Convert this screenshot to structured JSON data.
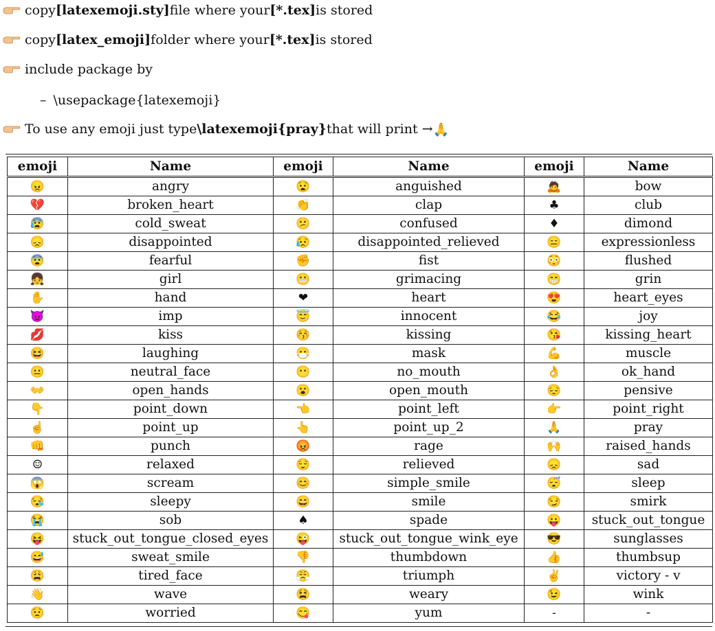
{
  "bullets": [
    {
      "pre": "copy ",
      "b1": "[latexemoji.sty]",
      "mid": " file where your ",
      "b2": "[*.tex]",
      "post": " is stored"
    },
    {
      "pre": "copy ",
      "b1": "[latex_emoji]",
      "mid": " folder where your ",
      "b2": "[*.tex]",
      "post": " is stored"
    },
    {
      "pre": "include package by"
    }
  ],
  "sub_item": "\\usepackage{latexemoji}",
  "usage": {
    "pre": "To use any emoji just type ",
    "cmd": "\\latexemoji{pray}",
    "post": " that will print → ",
    "emoji": "🙏"
  },
  "table": {
    "headers": [
      "emoji",
      "Name",
      "emoji",
      "Name",
      "emoji",
      "Name"
    ],
    "rows": [
      [
        {
          "e": "😠",
          "n": "angry"
        },
        {
          "e": "😧",
          "n": "anguished"
        },
        {
          "e": "🙇",
          "n": "bow"
        }
      ],
      [
        {
          "e": "💔",
          "n": "broken_heart"
        },
        {
          "e": "👏",
          "n": "clap"
        },
        {
          "e": "♣",
          "n": "club"
        }
      ],
      [
        {
          "e": "😰",
          "n": "cold_sweat"
        },
        {
          "e": "😕",
          "n": "confused"
        },
        {
          "e": "♦",
          "n": "dimond"
        }
      ],
      [
        {
          "e": "😞",
          "n": "disappointed"
        },
        {
          "e": "😥",
          "n": "disappointed_relieved"
        },
        {
          "e": "😑",
          "n": "expressionless"
        }
      ],
      [
        {
          "e": "😨",
          "n": "fearful"
        },
        {
          "e": "✊",
          "n": "fist"
        },
        {
          "e": "😳",
          "n": "flushed"
        }
      ],
      [
        {
          "e": "👧",
          "n": "girl"
        },
        {
          "e": "😬",
          "n": "grimacing"
        },
        {
          "e": "😁",
          "n": "grin"
        }
      ],
      [
        {
          "e": "✋",
          "n": "hand"
        },
        {
          "e": "❤",
          "n": "heart"
        },
        {
          "e": "😍",
          "n": "heart_eyes"
        }
      ],
      [
        {
          "e": "👿",
          "n": "imp"
        },
        {
          "e": "😇",
          "n": "innocent"
        },
        {
          "e": "😂",
          "n": "joy"
        }
      ],
      [
        {
          "e": "💋",
          "n": "kiss"
        },
        {
          "e": "😚",
          "n": "kissing"
        },
        {
          "e": "😘",
          "n": "kissing_heart"
        }
      ],
      [
        {
          "e": "😆",
          "n": "laughing"
        },
        {
          "e": "😷",
          "n": "mask"
        },
        {
          "e": "💪",
          "n": "muscle"
        }
      ],
      [
        {
          "e": "😐",
          "n": "neutral_face"
        },
        {
          "e": "😶",
          "n": "no_mouth"
        },
        {
          "e": "👌",
          "n": "ok_hand"
        }
      ],
      [
        {
          "e": "👐",
          "n": "open_hands"
        },
        {
          "e": "😮",
          "n": "open_mouth"
        },
        {
          "e": "😔",
          "n": "pensive"
        }
      ],
      [
        {
          "e": "👇",
          "n": "point_down"
        },
        {
          "e": "👈",
          "n": "point_left"
        },
        {
          "e": "👉",
          "n": "point_right"
        }
      ],
      [
        {
          "e": "☝",
          "n": "point_up"
        },
        {
          "e": "👆",
          "n": "point_up_2"
        },
        {
          "e": "🙏",
          "n": "pray"
        }
      ],
      [
        {
          "e": "👊",
          "n": "punch"
        },
        {
          "e": "😡",
          "n": "rage"
        },
        {
          "e": "🙌",
          "n": "raised_hands"
        }
      ],
      [
        {
          "e": "☺",
          "n": "relaxed"
        },
        {
          "e": "😌",
          "n": "relieved"
        },
        {
          "e": "😞",
          "n": "sad"
        }
      ],
      [
        {
          "e": "😱",
          "n": "scream"
        },
        {
          "e": "😊",
          "n": "simple_smile"
        },
        {
          "e": "😴",
          "n": "sleep"
        }
      ],
      [
        {
          "e": "😪",
          "n": "sleepy"
        },
        {
          "e": "😄",
          "n": "smile"
        },
        {
          "e": "😏",
          "n": "smirk"
        }
      ],
      [
        {
          "e": "😭",
          "n": "sob"
        },
        {
          "e": "♠",
          "n": "spade"
        },
        {
          "e": "😛",
          "n": "stuck_out_tongue"
        }
      ],
      [
        {
          "e": "😝",
          "n": "stuck_out_tongue_closed_eyes"
        },
        {
          "e": "😜",
          "n": "stuck_out_tongue_wink_eye"
        },
        {
          "e": "😎",
          "n": "sunglasses"
        }
      ],
      [
        {
          "e": "😅",
          "n": "sweat_smile"
        },
        {
          "e": "👎",
          "n": "thumbdown"
        },
        {
          "e": "👍",
          "n": "thumbsup"
        }
      ],
      [
        {
          "e": "😩",
          "n": "tired_face"
        },
        {
          "e": "😤",
          "n": "triumph"
        },
        {
          "e": "✌",
          "n": "victory - v"
        }
      ],
      [
        {
          "e": "👋",
          "n": "wave"
        },
        {
          "e": "😫",
          "n": "weary"
        },
        {
          "e": "😉",
          "n": "wink"
        }
      ],
      [
        {
          "e": "😟",
          "n": "worried"
        },
        {
          "e": "😋",
          "n": "yum"
        },
        {
          "e": "-",
          "n": "-"
        }
      ]
    ]
  }
}
